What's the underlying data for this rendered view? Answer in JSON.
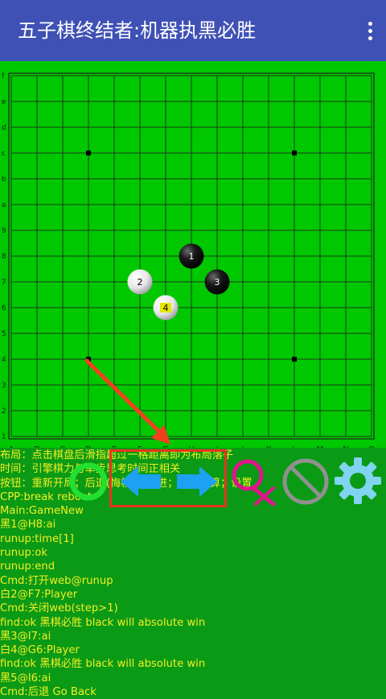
{
  "app": {
    "title": "五子棋终结者:机器执黑必胜",
    "menu_icon": "more-vert-icon"
  },
  "board": {
    "rows_labels": [
      "f",
      "e",
      "d",
      "c",
      "b",
      "a",
      "9",
      "8",
      "7",
      "6",
      "5",
      "4",
      "3",
      "2",
      "1"
    ],
    "cols_labels": [
      "A",
      "B",
      "C",
      "D",
      "E",
      "F",
      "G",
      "H",
      "I",
      "J",
      "K",
      "L",
      "M",
      "N",
      "O"
    ],
    "stones": [
      {
        "number": "1",
        "color": "black",
        "col": 8,
        "row": 8
      },
      {
        "number": "2",
        "color": "white",
        "col": 6,
        "row": 7
      },
      {
        "number": "3",
        "color": "black",
        "col": 9,
        "row": 7
      },
      {
        "number": "4",
        "color": "white",
        "col": 7,
        "row": 6
      }
    ],
    "star_points": [
      [
        4,
        12
      ],
      [
        12,
        12
      ],
      [
        4,
        4
      ],
      [
        12,
        4
      ]
    ],
    "colors": {
      "board": "#00c800",
      "grid": "#1a3a1a",
      "label": "#0c2a0c",
      "arrow": "#f04020",
      "highlight_box": "#e8341e",
      "last_move": "#e6e600"
    }
  },
  "toolbar": {
    "new_game_icon": "restart-ring-icon",
    "undo_icon": "arrow-left-icon",
    "redo_icon": "arrow-right-icon",
    "search_icon": "search-icon",
    "stop_icon": "stop-icon",
    "settings_icon": "gear-icon",
    "colors": {
      "new": "#22e030",
      "arrows": "#1da1f2",
      "search": "#e0148a",
      "stop": "#909090",
      "gear": "#80d4f0"
    }
  },
  "log": [
    "布局：点击棋盘后滑指超过一格距离即为布局落子",
    "时间：引擎棋力与单步思考时间正相关",
    "按钮：重新开局；后退(悔棋)；前进；停止计算；设置",
    "CPP:break reboot",
    "Main:GameNew",
    "黑1@H8:ai",
    "runup:time[1]",
    "runup:ok",
    "runup:end",
    "Cmd:打开web@runup",
    "白2@F7:Player",
    "Cmd:关闭web(step>1)",
    "find:ok 黑棋必胜 black will absolute win",
    "黑3@I7:ai",
    "白4@G6:Player",
    "find:ok 黑棋必胜 black will absolute win",
    "黑5@I6:ai",
    "Cmd:后退 Go Back"
  ]
}
